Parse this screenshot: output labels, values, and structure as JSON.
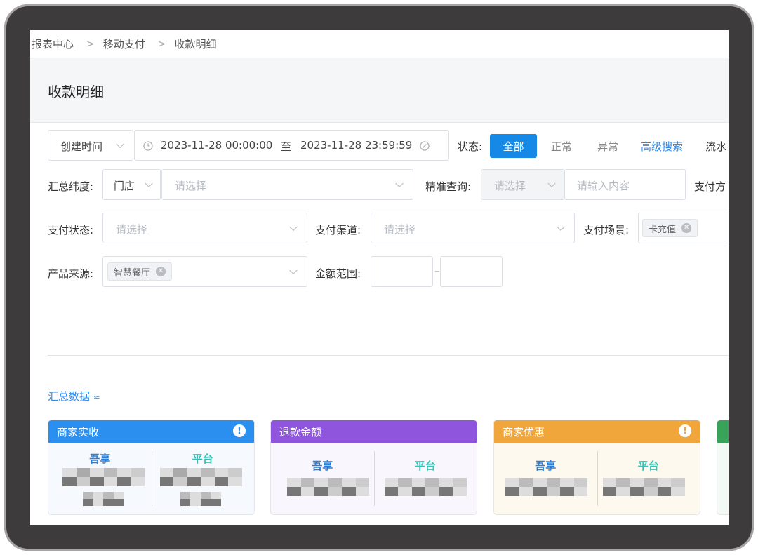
{
  "breadcrumb": [
    "报表中心",
    "移动支付",
    "收款明细"
  ],
  "page_title": "收款明细",
  "filters": {
    "time_type": "创建时间",
    "date_start": "2023-11-28 00:00:00",
    "date_sep": "至",
    "date_end": "2023-11-28 23:59:59",
    "status_label": "状态:",
    "status_options": [
      "全部",
      "正常",
      "异常"
    ],
    "advanced_search": "高级搜索",
    "flow_partial": "流水",
    "summary_dim_label": "汇总纬度:",
    "summary_dim_value": "门店",
    "summary_dim_placeholder": "请选择",
    "exact_query_label": "精准查询:",
    "exact_query_select_placeholder": "请选择",
    "exact_query_input_placeholder": "请输入内容",
    "pay_method_partial": "支付方",
    "pay_status_label": "支付状态:",
    "pay_status_placeholder": "请选择",
    "pay_channel_label": "支付渠道:",
    "pay_channel_placeholder": "请选择",
    "pay_scene_label": "支付场景:",
    "pay_scene_tag": "卡充值",
    "product_source_label": "产品来源:",
    "product_source_tag": "智慧餐厅",
    "amount_range_label": "金额范围:",
    "amount_sep": "–"
  },
  "summary": {
    "toggle_label": "汇总数据",
    "cards": [
      {
        "title": "商家实收",
        "color": "#2b8ff0",
        "left": "吾享",
        "right": "平台",
        "alert": "!"
      },
      {
        "title": "退款金额",
        "color": "#8f56dd",
        "left": "吾享",
        "right": "平台"
      },
      {
        "title": "商家优惠",
        "color": "#f0a63a",
        "left": "吾享",
        "right": "平台",
        "alert": "!"
      },
      {
        "title": "",
        "color": "#3aa35a"
      }
    ]
  },
  "colors": {
    "primary": "#1589e5",
    "link": "#2d8cf0",
    "left_label": "#2d7fd6",
    "right_label": "#36c2b4"
  }
}
